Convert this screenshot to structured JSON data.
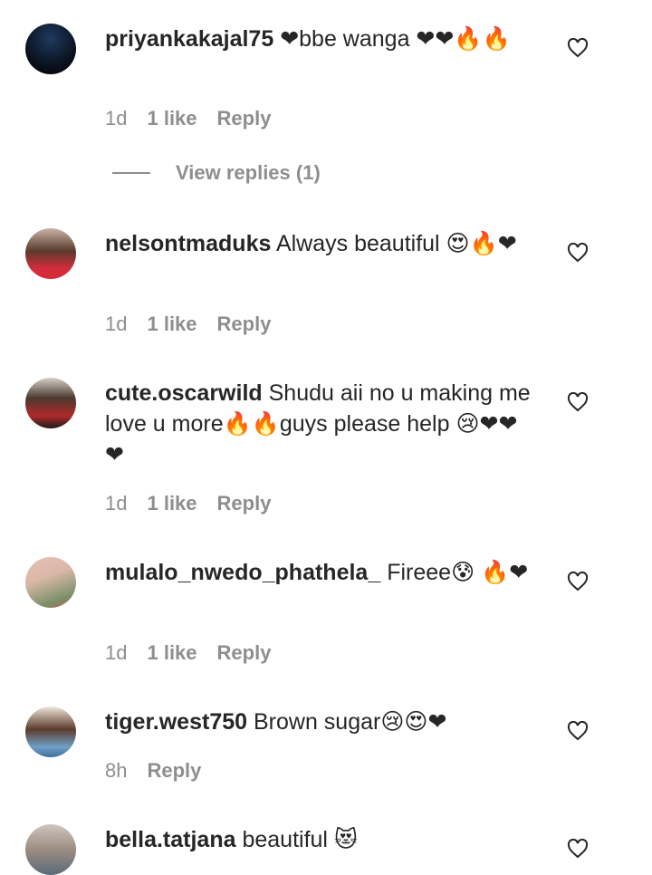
{
  "comments": [
    {
      "username": "priyankakajal75",
      "text": "❤bbe wanga ❤❤🔥🔥",
      "time": "1d",
      "likes": "1 like",
      "reply": "Reply",
      "view_replies": "View replies (1)",
      "avatar_colors": [
        "#0b1320",
        "#1e3a5f"
      ]
    },
    {
      "username": "nelsontmaduks",
      "text": "Always beautiful 😍🔥❤",
      "time": "1d",
      "likes": "1 like",
      "reply": "Reply",
      "avatar_colors": [
        "#c9b3a6",
        "#d62b3b"
      ]
    },
    {
      "username": "cute.oscarwild",
      "text": "Shudu aii no u making me love u more🔥🔥guys please help 😢❤❤❤",
      "time": "1d",
      "likes": "1 like",
      "reply": "Reply",
      "avatar_colors": [
        "#4a3a30",
        "#b02a2a"
      ]
    },
    {
      "username": "mulalo_nwedo_phathela_",
      "text": "Fireee😰 🔥❤",
      "time": "1d",
      "likes": "1 like",
      "reply": "Reply",
      "avatar_colors": [
        "#d9b7a7",
        "#7a8f6a"
      ]
    },
    {
      "username": "tiger.west750",
      "text": "Brown sugar😢😍❤",
      "time": "8h",
      "reply": "Reply",
      "avatar_colors": [
        "#5b3b2b",
        "#6fa0c9"
      ]
    },
    {
      "username": "bella.tatjana",
      "text": "beautiful 😻",
      "avatar_colors": [
        "#9c8c80",
        "#5a6b7a"
      ]
    }
  ],
  "icons": {
    "like": "heart-outline-icon"
  },
  "colors": {
    "text": "#262626",
    "muted": "#8e8e8e"
  }
}
